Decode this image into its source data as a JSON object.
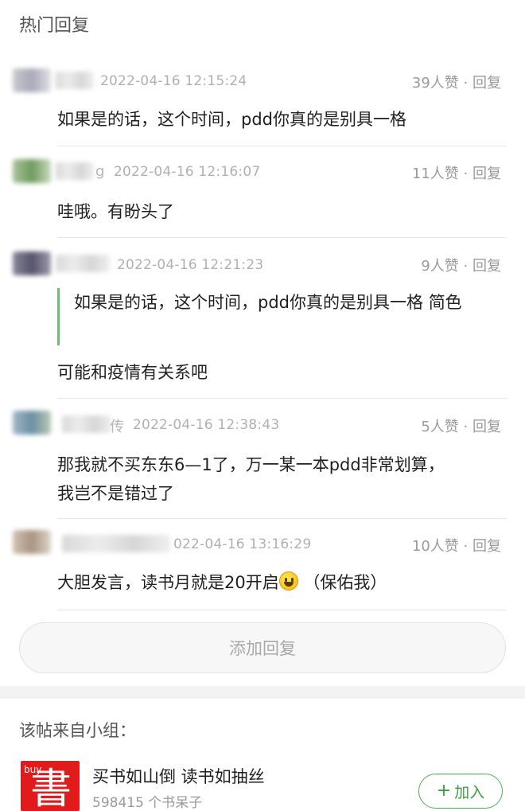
{
  "section_title": "热门回复",
  "comments": [
    {
      "name_tail": "",
      "time": "2022-04-16 12:15:24",
      "likes": "39人赞",
      "reply": "· 回复",
      "text": "如果是的话，这个时间，pdd你真的是别具一格",
      "avatar_color": "#b9b9c4"
    },
    {
      "name_tail": "g",
      "time": "2022-04-16 12:16:07",
      "likes": "11人赞",
      "reply": "· 回复",
      "text": "哇哦。有盼头了",
      "avatar_color": "#8cab79"
    },
    {
      "name_tail": "",
      "time": "2022-04-16 12:21:23",
      "likes": "9人赞",
      "reply": "· 回复",
      "quote_text": "如果是的话，这个时间，pdd你真的是别具一格",
      "quote_author": "简色",
      "text": "可能和疫情有关系吧",
      "avatar_color": "#6c6a7e"
    },
    {
      "name_tail": "传",
      "time": "2022-04-16 12:38:43",
      "likes": "5人赞",
      "reply": "· 回复",
      "text_line1": "那我就不买东东6—1了，万一某一本pdd非常划算，",
      "text_line2": "我岂不是错过了",
      "avatar_color": "#7f9fb0"
    },
    {
      "name_tail": "",
      "time": "022-04-16 13:16:29",
      "likes": "10人赞",
      "reply": "· 回复",
      "text_before": "大胆发言，读书月就是20开启",
      "text_after": " （保佑我）",
      "avatar_color": "#bfae9e"
    }
  ],
  "add_reply_label": "添加回复",
  "group": {
    "header": "该帖来自小组：",
    "logo_small": "buy",
    "logo_glyph": "書",
    "name": "买书如山倒 读书如抽丝",
    "members": "598415 个书呆子",
    "join_label": "加入"
  }
}
